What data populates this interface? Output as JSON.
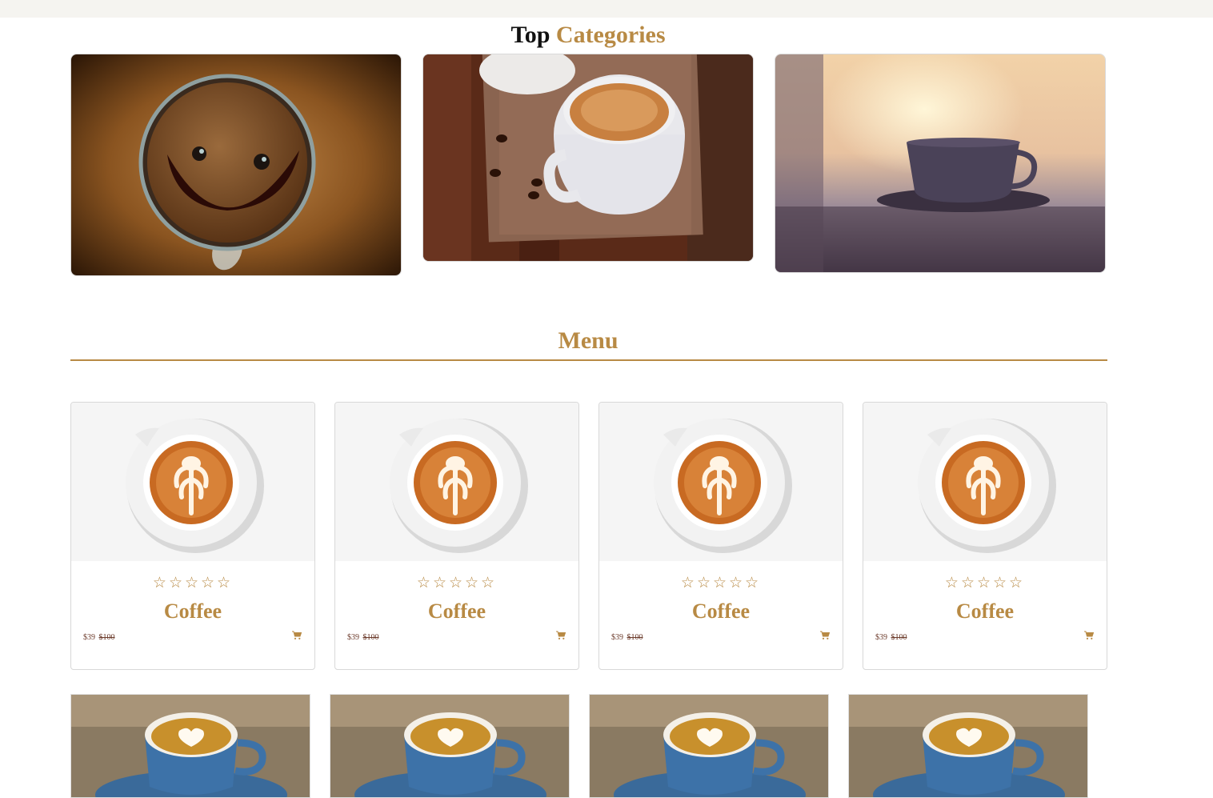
{
  "categories": {
    "title_word1": "Top",
    "title_word2": "Categories",
    "items": [
      {
        "image": "smiling-coffee-cup-photo"
      },
      {
        "image": "white-cup-on-napkin-photo"
      },
      {
        "image": "cup-at-sunset-window-photo"
      }
    ]
  },
  "menu": {
    "title": "Menu",
    "products": [
      {
        "name": "Coffee",
        "price": "$39",
        "old_price": "$100",
        "rating": 0,
        "stars": "☆☆☆☆☆",
        "icon": "cart-icon"
      },
      {
        "name": "Coffee",
        "price": "$39",
        "old_price": "$100",
        "rating": 0,
        "stars": "☆☆☆☆☆",
        "icon": "cart-icon"
      },
      {
        "name": "Coffee",
        "price": "$39",
        "old_price": "$100",
        "rating": 0,
        "stars": "☆☆☆☆☆",
        "icon": "cart-icon"
      },
      {
        "name": "Coffee",
        "price": "$39",
        "old_price": "$100",
        "rating": 0,
        "stars": "☆☆☆☆☆",
        "icon": "cart-icon"
      }
    ]
  },
  "colors": {
    "accent": "#b88a44",
    "price": "#6b3a2a",
    "topbar": "#f5f4f0"
  }
}
